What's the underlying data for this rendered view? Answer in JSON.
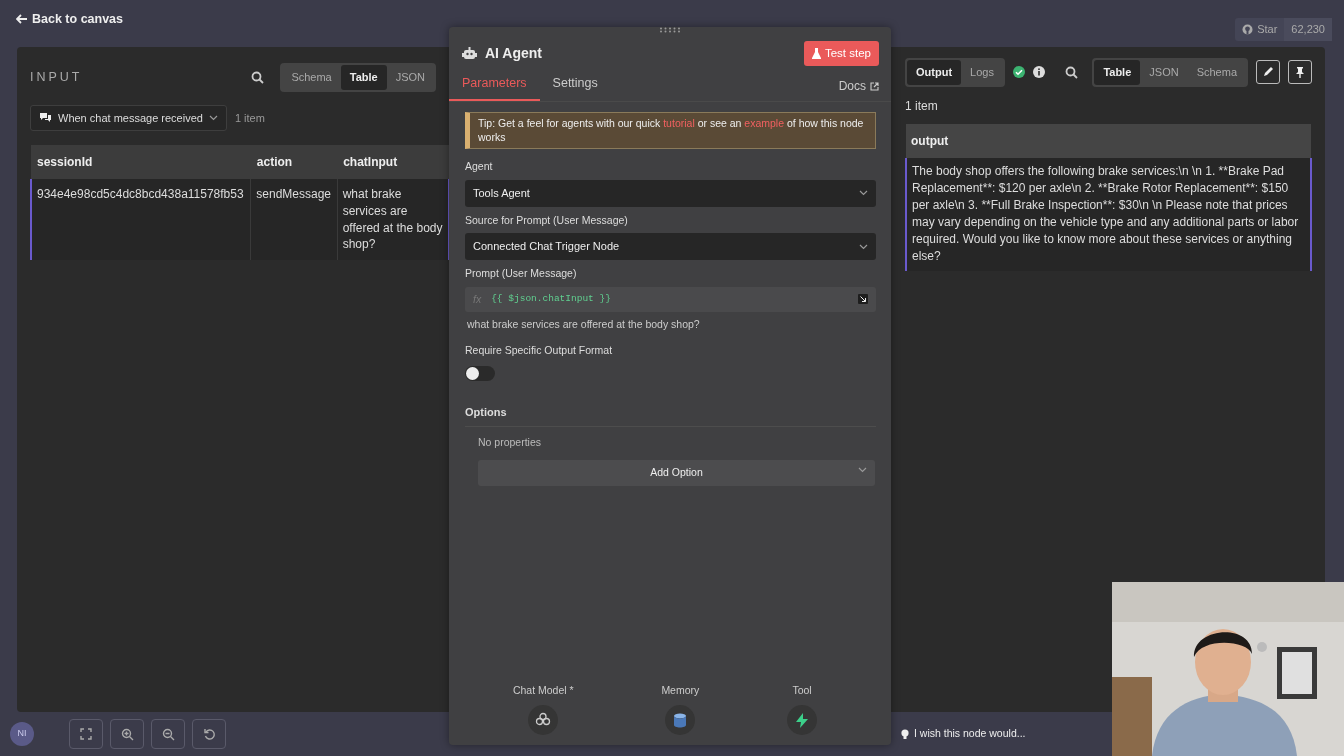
{
  "top_bar": {
    "back_link": "Back to canvas",
    "github_star": {
      "label": "Star",
      "count": "62,230"
    }
  },
  "input_panel": {
    "title": "INPUT",
    "view_tabs": [
      {
        "label": "Schema",
        "selected": false
      },
      {
        "label": "Table",
        "selected": true
      },
      {
        "label": "JSON",
        "selected": false
      }
    ],
    "source_select": "When chat message received",
    "item_count": "1 item",
    "table": {
      "columns": [
        "sessionId",
        "action",
        "chatInput"
      ],
      "rows": [
        [
          "934e4e98cd5c4dc8bcd438a11578fb53",
          "sendMessage",
          "what brake services are offered at the body shop?"
        ]
      ]
    }
  },
  "node_panel": {
    "title": "AI Agent",
    "test_button": "Test step",
    "tabs": [
      {
        "label": "Parameters",
        "selected": true
      },
      {
        "label": "Settings",
        "selected": false
      }
    ],
    "docs_link": "Docs",
    "tip": [
      {
        "kind": "text",
        "text": "Tip: Get a feel for agents with our quick "
      },
      {
        "kind": "link",
        "text": "tutorial"
      },
      {
        "kind": "text",
        "text": " or see an "
      },
      {
        "kind": "link",
        "text": "example"
      },
      {
        "kind": "text",
        "text": " of how this node works"
      }
    ],
    "fields": [
      {
        "kind": "select",
        "label": "Agent",
        "value": "Tools Agent"
      },
      {
        "kind": "select",
        "label": "Source for Prompt (User Message)",
        "value": "Connected Chat Trigger Node"
      },
      {
        "kind": "expression",
        "label": "Prompt (User Message)",
        "prefix": "fx",
        "value": "{{ $json.chatInput }}",
        "preview": "what brake services are offered at the body shop?"
      },
      {
        "kind": "toggle",
        "label": "Require Specific Output Format",
        "on": false
      }
    ],
    "options": {
      "label": "Options",
      "empty_text": "No properties",
      "add_button": "Add Option"
    },
    "sub_nodes": [
      {
        "kind": "chat_model",
        "label": "Chat Model *"
      },
      {
        "kind": "memory",
        "label": "Memory"
      },
      {
        "kind": "tool",
        "label": "Tool"
      }
    ]
  },
  "output_panel": {
    "mode_tabs": [
      {
        "label": "Output",
        "selected": true
      },
      {
        "label": "Logs",
        "selected": false
      }
    ],
    "view_tabs": [
      {
        "label": "Table",
        "selected": true
      },
      {
        "label": "JSON",
        "selected": false
      },
      {
        "label": "Schema",
        "selected": false
      }
    ],
    "item_count": "1 item",
    "table": {
      "columns": [
        "output"
      ],
      "rows": [
        [
          "The body shop offers the following brake services:\\n \\n 1. **Brake Pad Replacement**: $120 per axle\\n 2. **Brake Rotor Replacement**: $150 per axle\\n 3. **Full Brake Inspection**: $30\\n \\n Please note that prices may vary depending on the vehicle type and any additional parts or labor required. Would you like to know more about these services or anything else?"
        ]
      ]
    }
  },
  "canvas_controls": {
    "avatar": "NI"
  },
  "feedback": "I wish this node would..."
}
